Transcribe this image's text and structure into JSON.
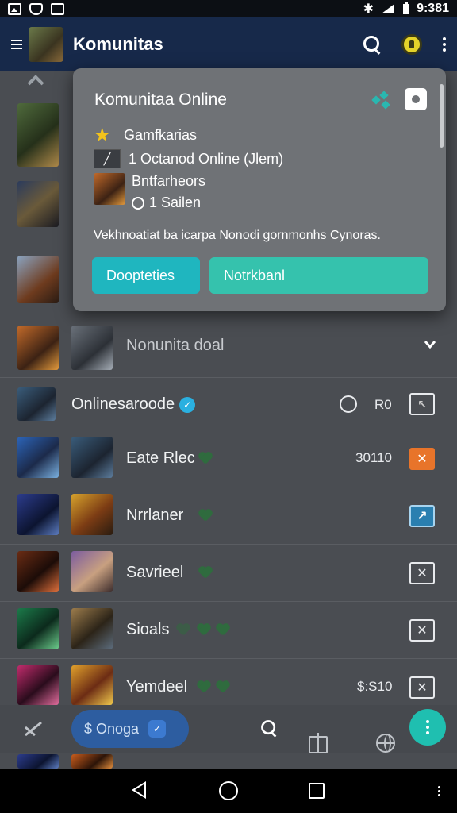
{
  "status_bar": {
    "time": "9:381",
    "icons": [
      "gallery-icon",
      "shield-icon",
      "chart-icon",
      "bluetooth-icon",
      "signal-icon",
      "battery-icon"
    ]
  },
  "app_bar": {
    "title": "Komunitas"
  },
  "popup": {
    "title": "Komunitaa Online",
    "line1": "Gamfkarias",
    "line2": "1 Octanod Online (Jlem)",
    "line3_title": "Bntfarheors",
    "line3_sub": "1 Sailen",
    "description": "Vekhnoatiat ba icarpa Nonodi gornmonhs Cynoras.",
    "button_primary": "Doopteties",
    "button_secondary": "Notrkbanl"
  },
  "section_header": {
    "label": "Nonunita doal"
  },
  "online_header": {
    "label": "Onlinesaroode",
    "verified": "✓",
    "count": "R0"
  },
  "rows": [
    {
      "name": "Eate Rlec",
      "count": "30110",
      "action": "✕"
    },
    {
      "name": "Nrrlaner",
      "action": "↗"
    },
    {
      "name": "Savrieel",
      "action": "✕"
    },
    {
      "name": "Sioals",
      "action": "✕"
    },
    {
      "name": "Yemdeel",
      "count": "$:S10",
      "action": "✕"
    }
  ],
  "bottom_bar": {
    "pill_label": "$ Onoga",
    "pill_badge": "✓"
  },
  "colors": {
    "app_bar": "#17294a",
    "accent_teal": "#1fb6bf",
    "accent_orange": "#e8742a",
    "star": "#f2c21b"
  }
}
